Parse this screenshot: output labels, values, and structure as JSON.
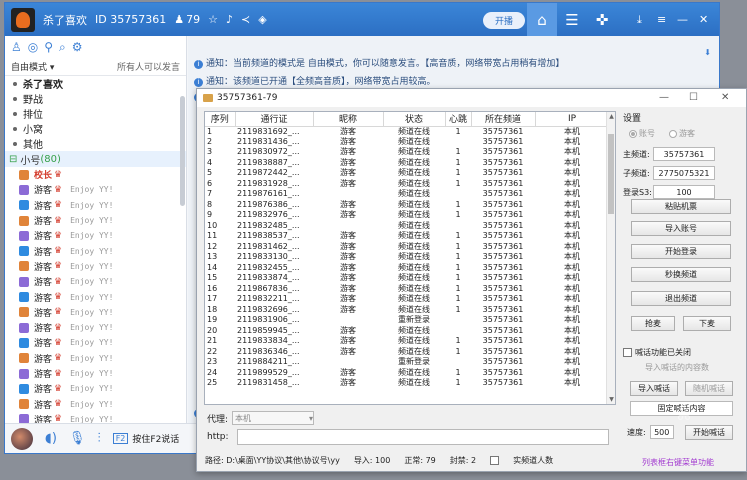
{
  "yy": {
    "title": "杀了喜欢",
    "id_text": "ID 35757361",
    "count": "79",
    "open_label": "开播",
    "mode": "自由模式",
    "mode_hint": "所有人可以发言",
    "channels": [
      {
        "label": "杀了喜欢",
        "main": true
      },
      {
        "label": "野战",
        "main": false
      },
      {
        "label": "排位",
        "main": false
      },
      {
        "label": "小窝",
        "main": false
      },
      {
        "label": "其他",
        "main": false
      }
    ],
    "small_channel": {
      "label": "小号",
      "count": "(80)"
    },
    "members": [
      {
        "badge": "校长",
        "name": "",
        "sig": "",
        "head": true
      },
      {
        "badge": "",
        "name": "游客",
        "sig": "Enjoy YY!"
      },
      {
        "badge": "",
        "name": "游客",
        "sig": "Enjoy YY!"
      },
      {
        "badge": "",
        "name": "游客",
        "sig": "Enjoy YY!"
      },
      {
        "badge": "",
        "name": "游客",
        "sig": "Enjoy YY!"
      },
      {
        "badge": "",
        "name": "游客",
        "sig": "Enjoy YY!"
      },
      {
        "badge": "",
        "name": "游客",
        "sig": "Enjoy YY!"
      },
      {
        "badge": "",
        "name": "游客",
        "sig": "Enjoy YY!"
      },
      {
        "badge": "",
        "name": "游客",
        "sig": "Enjoy YY!"
      },
      {
        "badge": "",
        "name": "游客",
        "sig": "Enjoy YY!"
      },
      {
        "badge": "",
        "name": "游客",
        "sig": "Enjoy YY!"
      },
      {
        "badge": "",
        "name": "游客",
        "sig": "Enjoy YY!"
      },
      {
        "badge": "",
        "name": "游客",
        "sig": "Enjoy YY!"
      },
      {
        "badge": "",
        "name": "游客",
        "sig": "Enjoy YY!"
      },
      {
        "badge": "",
        "name": "游客",
        "sig": "Enjoy YY!"
      },
      {
        "badge": "",
        "name": "游客",
        "sig": "Enjoy YY!"
      },
      {
        "badge": "",
        "name": "游客",
        "sig": "Enjoy YY!"
      }
    ],
    "notices": [
      "通知：当前频道的模式是 自由模式，你可以随意发言。【高音质，网络带宽占用稍有增加】",
      "通知：该频道已开通【全频高音质】，网络带宽占用较高。"
    ],
    "f2_key": "F2",
    "f2_text": "按住F2说话"
  },
  "tool": {
    "title": "35757361-79",
    "columns": [
      "序列",
      "通行证",
      "昵称",
      "状态",
      "心跳",
      "所在频道",
      "IP"
    ],
    "rows": [
      [
        "1",
        "2119831692_...",
        "游客",
        "频道在线",
        "1",
        "35757361",
        "本机"
      ],
      [
        "2",
        "2119831436_...",
        "游客",
        "频道在线",
        "",
        "35757361",
        "本机"
      ],
      [
        "3",
        "2119830972_...",
        "游客",
        "频道在线",
        "1",
        "35757361",
        "本机"
      ],
      [
        "4",
        "2119838887_...",
        "游客",
        "频道在线",
        "1",
        "35757361",
        "本机"
      ],
      [
        "5",
        "2119872442_...",
        "游客",
        "频道在线",
        "1",
        "35757361",
        "本机"
      ],
      [
        "6",
        "2119831928_...",
        "游客",
        "频道在线",
        "1",
        "35757361",
        "本机"
      ],
      [
        "7",
        "2119876161_...",
        "",
        "频道在线",
        "",
        "35757361",
        "本机"
      ],
      [
        "8",
        "2119876386_...",
        "游客",
        "频道在线",
        "1",
        "35757361",
        "本机"
      ],
      [
        "9",
        "2119832976_...",
        "游客",
        "频道在线",
        "1",
        "35757361",
        "本机"
      ],
      [
        "10",
        "2119832485_...",
        "",
        "频道在线",
        "",
        "35757361",
        "本机"
      ],
      [
        "11",
        "2119838537_...",
        "游客",
        "频道在线",
        "1",
        "35757361",
        "本机"
      ],
      [
        "12",
        "2119831462_...",
        "游客",
        "频道在线",
        "1",
        "35757361",
        "本机"
      ],
      [
        "13",
        "2119833130_...",
        "游客",
        "频道在线",
        "1",
        "35757361",
        "本机"
      ],
      [
        "14",
        "2119832455_...",
        "游客",
        "频道在线",
        "1",
        "35757361",
        "本机"
      ],
      [
        "15",
        "2119833874_...",
        "游客",
        "频道在线",
        "1",
        "35757361",
        "本机"
      ],
      [
        "16",
        "2119867836_...",
        "游客",
        "频道在线",
        "1",
        "35757361",
        "本机"
      ],
      [
        "17",
        "2119832211_...",
        "游客",
        "频道在线",
        "1",
        "35757361",
        "本机"
      ],
      [
        "18",
        "2119832696_...",
        "游客",
        "频道在线",
        "1",
        "35757361",
        "本机"
      ],
      [
        "19",
        "2119831906_...",
        "",
        "重新登录",
        "",
        "35757361",
        "本机"
      ],
      [
        "20",
        "2119859945_...",
        "游客",
        "频道在线",
        "",
        "35757361",
        "本机"
      ],
      [
        "21",
        "2119833834_...",
        "游客",
        "频道在线",
        "1",
        "35757361",
        "本机"
      ],
      [
        "22",
        "2119836346_...",
        "游客",
        "频道在线",
        "1",
        "35757361",
        "本机"
      ],
      [
        "23",
        "2119884211_...",
        "",
        "重新登录",
        "",
        "35757361",
        "本机"
      ],
      [
        "24",
        "2119899529_...",
        "游客",
        "频道在线",
        "1",
        "35757361",
        "本机"
      ],
      [
        "25",
        "2119831458_...",
        "游客",
        "频道在线",
        "1",
        "35757361",
        "本机"
      ]
    ],
    "proxy_label": "代理:",
    "proxy_value": "本机",
    "http_label": "http:",
    "status_path": "路径: D:\\桌面\\YY协议\\其他\\协议号\\yy",
    "status_import": "导入: 100",
    "status_normal": "正常: 79",
    "status_banned": "封禁: 2",
    "status_check": "实频道人数",
    "menu_hint": "列表框右键菜单功能",
    "settings": {
      "title": "设置",
      "radio_account": "账号",
      "radio_tourist": "游客",
      "main_channel_label": "主频道:",
      "main_channel": "35757361",
      "sub_channel_label": "子频道:",
      "sub_channel": "2775075321",
      "login_label": "登录S3:",
      "login_value": "100",
      "btn_paste": "粘贴机票",
      "btn_import": "导入账号",
      "btn_login": "开始登录",
      "btn_switch": "秒换频道",
      "btn_quit": "退出频道",
      "btn_grab": "抢麦",
      "btn_down": "下麦",
      "voice_check": "喊话功能已关闭",
      "voice_import_text": "导入喊话的内容数",
      "btn_import_voice": "导入喊话",
      "btn_random_voice": "随机喊话",
      "voice_fixed": "固定喊话内容",
      "speed_label": "速度:",
      "speed_value": "500",
      "btn_start_voice": "开始喊话"
    }
  }
}
